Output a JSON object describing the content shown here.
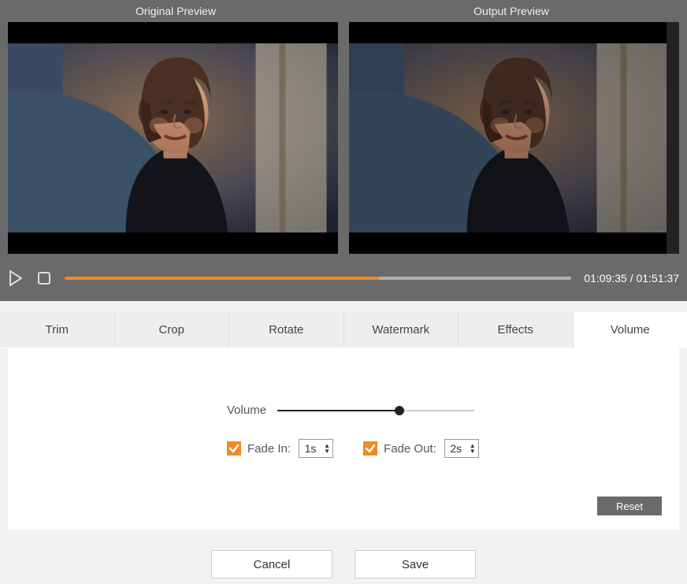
{
  "previews": {
    "original_label": "Original Preview",
    "output_label": "Output  Preview"
  },
  "playback": {
    "current_time": "01:09:35",
    "total_time": "01:51:37",
    "progress_percent": 62
  },
  "tabs": [
    {
      "id": "trim",
      "label": "Trim",
      "active": false
    },
    {
      "id": "crop",
      "label": "Crop",
      "active": false
    },
    {
      "id": "rotate",
      "label": "Rotate",
      "active": false
    },
    {
      "id": "watermark",
      "label": "Watermark",
      "active": false
    },
    {
      "id": "effects",
      "label": "Effects",
      "active": false
    },
    {
      "id": "volume",
      "label": "Volume",
      "active": true
    }
  ],
  "volume_panel": {
    "label": "Volume",
    "level_percent": 62,
    "fade_in": {
      "checked": true,
      "label": "Fade In:",
      "value": "1s"
    },
    "fade_out": {
      "checked": true,
      "label": "Fade Out:",
      "value": "2s"
    },
    "reset_label": "Reset"
  },
  "actions": {
    "cancel": "Cancel",
    "save": "Save"
  },
  "colors": {
    "accent": "#f08a24",
    "gray_bg": "#6a6a6a"
  }
}
